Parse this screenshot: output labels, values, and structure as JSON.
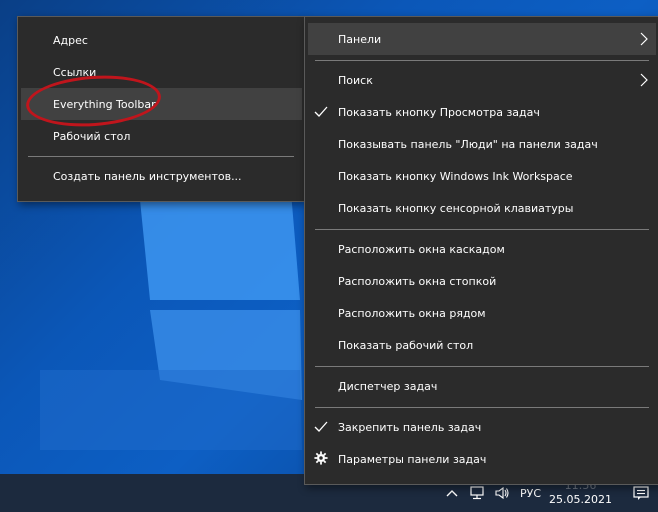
{
  "toolbars_submenu": {
    "items": [
      {
        "label": "Адрес"
      },
      {
        "label": "Ссылки"
      },
      {
        "label": "Everything Toolbar",
        "highlighted": true
      },
      {
        "label": "Рабочий стол"
      }
    ],
    "new_toolbar_label": "Создать панель инструментов..."
  },
  "taskbar_menu": {
    "panels_label": "Панели",
    "search_label": "Поиск",
    "show_task_view": "Показать кнопку Просмотра задач",
    "show_people": "Показывать панель \"Люди\" на панели задач",
    "show_ink": "Показать кнопку Windows Ink Workspace",
    "show_touch_keyboard": "Показать кнопку сенсорной клавиатуры",
    "cascade": "Расположить окна каскадом",
    "stacked": "Расположить окна стопкой",
    "side_by_side": "Расположить окна рядом",
    "show_desktop": "Показать рабочий стол",
    "task_manager": "Диспетчер задач",
    "lock_taskbar": "Закрепить панель задач",
    "taskbar_settings": "Параметры панели задач"
  },
  "tray": {
    "language": "РУС",
    "time": "11:56",
    "date": "25.05.2021"
  },
  "icons": {
    "submenu_arrow": "chevron-right-icon",
    "checked": "checkmark-icon",
    "settings": "gear-icon",
    "tray_overflow": "chevron-up-icon",
    "network": "network-icon",
    "volume": "speaker-icon",
    "notifications": "action-center-icon"
  },
  "colors": {
    "menu_background": "#2b2b2b",
    "menu_hover": "#414141",
    "annotation": "#c0151c",
    "taskbar": "#1c2a3e"
  }
}
